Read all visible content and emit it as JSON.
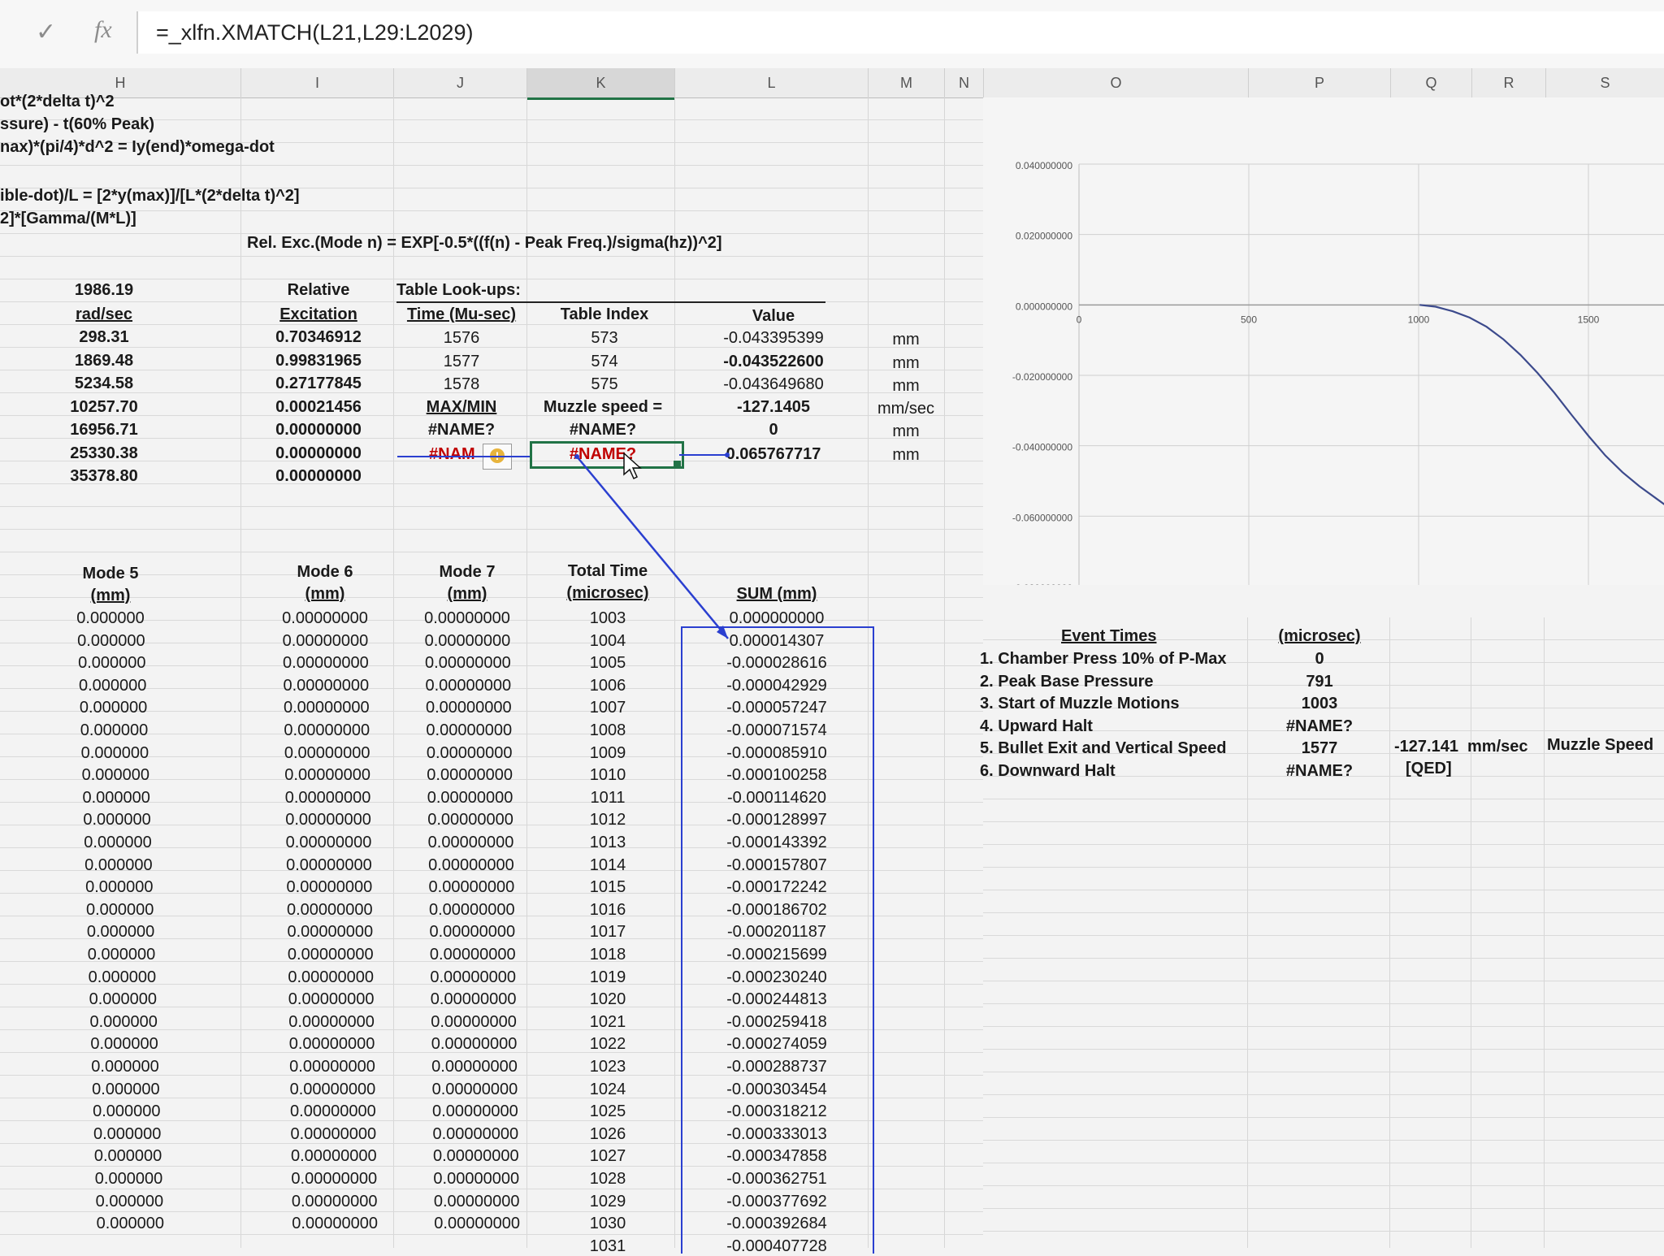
{
  "formula_bar": {
    "cancel_icon": "check-icon",
    "fx_label": "fx",
    "formula": "=_xlfn.XMATCH(L21,L29:L2029)"
  },
  "columns": [
    "H",
    "I",
    "J",
    "K",
    "L",
    "M",
    "N",
    "O",
    "P",
    "Q",
    "R",
    "S"
  ],
  "selected_column": "K",
  "notes": [
    "ot*(2*delta t)^2",
    "ssure) - t(60% Peak)",
    "nax)*(pi/4)*d^2 = Iy(end)*omega-dot",
    "ible-dot)/L = [2*y(max)]/[L*(2*delta t)^2]",
    "2]*[Gamma/(M*L)]",
    "Rel. Exc.(Mode n) = EXP[-0.5*((f(n) - Peak Freq.)/sigma(hz))^2]"
  ],
  "modes": {
    "col_h_header": [
      "1986.19",
      "rad/sec"
    ],
    "col_h": [
      "298.31",
      "1869.48",
      "5234.58",
      "10257.70",
      "16956.71",
      "25330.38",
      "35378.80"
    ],
    "col_i_header": [
      "Relative",
      "Excitation"
    ],
    "col_i": [
      "0.70346912",
      "0.99831965",
      "0.27177845",
      "0.00021456",
      "0.00000000",
      "0.00000000",
      "0.00000000"
    ]
  },
  "lookup": {
    "title": "Table Look-ups:",
    "headers": [
      "Time (Mu-sec)",
      "Table Index",
      "Value"
    ],
    "rows": [
      [
        "1576",
        "573",
        "-0.043395399",
        "mm"
      ],
      [
        "1577",
        "574",
        "-0.043522600",
        "mm"
      ],
      [
        "1578",
        "575",
        "-0.043649680",
        "mm"
      ]
    ],
    "maxmin_label": "MAX/MIN",
    "muzzle_label": "Muzzle speed =",
    "muzzle_value": "-127.1405",
    "muzzle_unit": "mm/sec",
    "row_a": [
      "#NAME?",
      "#NAME?",
      "0",
      "mm"
    ],
    "row_b": [
      "#NAM",
      "#NAME?",
      "0.065767717",
      "mm"
    ]
  },
  "table": {
    "headers": {
      "h": [
        "Mode 5",
        "(mm)"
      ],
      "i": [
        "Mode 6",
        "(mm)"
      ],
      "j": [
        "Mode 7",
        "(mm)"
      ],
      "k": [
        "Total Time",
        "(microsec)"
      ],
      "l": [
        "",
        "SUM (mm)"
      ]
    },
    "rows": [
      [
        "0.000000",
        "0.00000000",
        "0.00000000",
        "1003",
        "0.000000000"
      ],
      [
        "0.000000",
        "0.00000000",
        "0.00000000",
        "1004",
        "0.000014307"
      ],
      [
        "0.000000",
        "0.00000000",
        "0.00000000",
        "1005",
        "-0.000028616"
      ],
      [
        "0.000000",
        "0.00000000",
        "0.00000000",
        "1006",
        "-0.000042929"
      ],
      [
        "0.000000",
        "0.00000000",
        "0.00000000",
        "1007",
        "-0.000057247"
      ],
      [
        "0.000000",
        "0.00000000",
        "0.00000000",
        "1008",
        "-0.000071574"
      ],
      [
        "0.000000",
        "0.00000000",
        "0.00000000",
        "1009",
        "-0.000085910"
      ],
      [
        "0.000000",
        "0.00000000",
        "0.00000000",
        "1010",
        "-0.000100258"
      ],
      [
        "0.000000",
        "0.00000000",
        "0.00000000",
        "1011",
        "-0.000114620"
      ],
      [
        "0.000000",
        "0.00000000",
        "0.00000000",
        "1012",
        "-0.000128997"
      ],
      [
        "0.000000",
        "0.00000000",
        "0.00000000",
        "1013",
        "-0.000143392"
      ],
      [
        "0.000000",
        "0.00000000",
        "0.00000000",
        "1014",
        "-0.000157807"
      ],
      [
        "0.000000",
        "0.00000000",
        "0.00000000",
        "1015",
        "-0.000172242"
      ],
      [
        "0.000000",
        "0.00000000",
        "0.00000000",
        "1016",
        "-0.000186702"
      ],
      [
        "0.000000",
        "0.00000000",
        "0.00000000",
        "1017",
        "-0.000201187"
      ],
      [
        "0.000000",
        "0.00000000",
        "0.00000000",
        "1018",
        "-0.000215699"
      ],
      [
        "0.000000",
        "0.00000000",
        "0.00000000",
        "1019",
        "-0.000230240"
      ],
      [
        "0.000000",
        "0.00000000",
        "0.00000000",
        "1020",
        "-0.000244813"
      ],
      [
        "0.000000",
        "0.00000000",
        "0.00000000",
        "1021",
        "-0.000259418"
      ],
      [
        "0.000000",
        "0.00000000",
        "0.00000000",
        "1022",
        "-0.000274059"
      ],
      [
        "0.000000",
        "0.00000000",
        "0.00000000",
        "1023",
        "-0.000288737"
      ],
      [
        "0.000000",
        "0.00000000",
        "0.00000000",
        "1024",
        "-0.000303454"
      ],
      [
        "0.000000",
        "0.00000000",
        "0.00000000",
        "1025",
        "-0.000318212"
      ],
      [
        "0.000000",
        "0.00000000",
        "0.00000000",
        "1026",
        "-0.000333013"
      ],
      [
        "0.000000",
        "0.00000000",
        "0.00000000",
        "1027",
        "-0.000347858"
      ],
      [
        "0.000000",
        "0.00000000",
        "0.00000000",
        "1028",
        "-0.000362751"
      ],
      [
        "0.000000",
        "0.00000000",
        "0.00000000",
        "1029",
        "-0.000377692"
      ],
      [
        "0.000000",
        "0.00000000",
        "0.00000000",
        "1030",
        "-0.000392684"
      ],
      [
        "",
        "",
        "",
        "1031",
        "-0.000407728"
      ]
    ]
  },
  "events": {
    "title": "Event Times",
    "unit_header": "(microsec)",
    "items": [
      {
        "label": "1. Chamber Press 10% of P-Max",
        "value": "0"
      },
      {
        "label": "2. Peak Base Pressure",
        "value": "791"
      },
      {
        "label": "3. Start of Muzzle Motions",
        "value": "1003"
      },
      {
        "label": "4. Upward Halt",
        "value": "#NAME?"
      },
      {
        "label": "5. Bullet Exit and Vertical Speed",
        "value": "1577"
      },
      {
        "label": "6. Downward Halt",
        "value": "#NAME?"
      }
    ],
    "speed_value": "-127.141",
    "speed_unit": "mm/sec",
    "speed_label": "Muzzle Speed",
    "qed": "[QED]"
  },
  "chart_data": {
    "type": "line",
    "title": "",
    "xlabel": "",
    "ylabel": "",
    "x_ticks": [
      "0",
      "500",
      "1000",
      "1500"
    ],
    "y_ticks": [
      "0.040000000",
      "0.020000000",
      "0.000000000",
      "-0.020000000",
      "-0.040000000",
      "-0.060000000",
      "-0.080000000"
    ],
    "xlim": [
      0,
      1820
    ],
    "ylim": [
      -0.08,
      0.04
    ],
    "grid": true,
    "x_axis_at": 0,
    "color": "#3c4a8c",
    "series": [
      {
        "x": [
          1003,
          1050,
          1100,
          1150,
          1200,
          1250,
          1300,
          1350,
          1400,
          1450,
          1500,
          1550,
          1600,
          1650,
          1700,
          1750,
          1790
        ],
        "y": [
          0,
          -0.0005,
          -0.0018,
          -0.0036,
          -0.0062,
          -0.0098,
          -0.0142,
          -0.0193,
          -0.025,
          -0.0312,
          -0.0372,
          -0.0428,
          -0.0475,
          -0.0515,
          -0.055,
          -0.0585,
          -0.061
        ]
      }
    ]
  }
}
